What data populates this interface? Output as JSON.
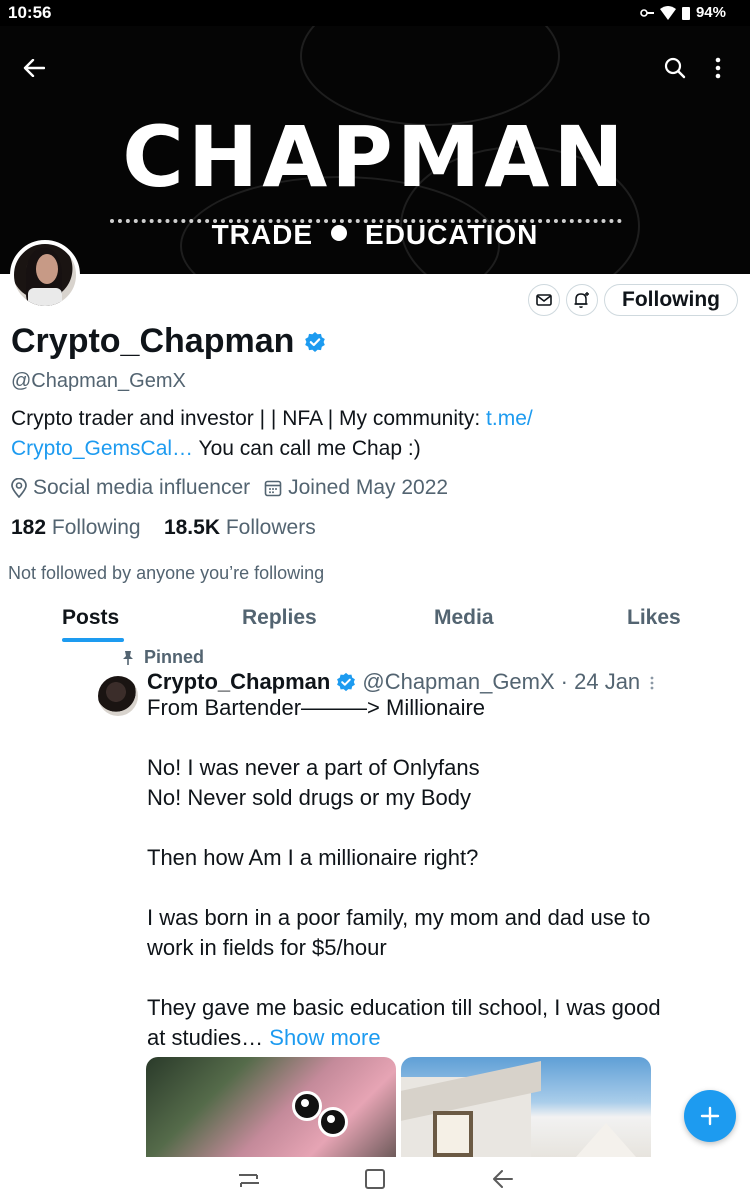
{
  "status_bar": {
    "time": "10:56",
    "battery": "94%"
  },
  "banner": {
    "title": "CHAPMAN",
    "subtitle_left": "TRADE",
    "subtitle_right": "EDUCATION"
  },
  "profile": {
    "display_name": "Crypto_Chapman",
    "handle": "@Chapman_GemX",
    "bio_text": "Crypto trader and investor | | NFA | My community: ",
    "bio_link": "t.me/ Crypto_GemsCal…",
    "bio_suffix": " You can call me Chap :)",
    "location": "Social media influencer",
    "joined": "Joined May 2022",
    "following_count": "182",
    "following_label": "Following",
    "followers_count": "18.5K",
    "followers_label": "Followers",
    "not_followed": "Not followed by anyone you’re following"
  },
  "actions": {
    "following_button": "Following"
  },
  "tabs": [
    {
      "label": "Posts",
      "active": true
    },
    {
      "label": "Replies",
      "active": false
    },
    {
      "label": "Media",
      "active": false
    },
    {
      "label": "Likes",
      "active": false
    }
  ],
  "post": {
    "pinned_label": "Pinned",
    "author_name": "Crypto_Chapman",
    "author_handle": "@Chapman_GemX",
    "date": "· 24 Jan",
    "paragraphs": [
      "From Bartender———> Millionaire",
      "No! I was never a part of Onlyfans\nNo! Never sold drugs or my Body",
      "Then how Am I a millionaire right?",
      "I was born in a poor family, my mom and dad use to work in fields for $5/hour",
      "They gave me basic education till school, I was good at studies…"
    ],
    "show_more": "Show more"
  },
  "icons": {
    "back": "arrow-left-icon",
    "search": "search-icon",
    "more": "more-vertical-icon",
    "message": "envelope-icon",
    "notify": "bell-plus-icon",
    "verified": "verified-badge-icon",
    "location": "location-pin-icon",
    "calendar": "calendar-icon",
    "pin": "pin-icon",
    "compose": "plus-icon"
  },
  "colors": {
    "accent": "#1d9bf0",
    "text": "#0f1419",
    "secondary": "#536471"
  }
}
